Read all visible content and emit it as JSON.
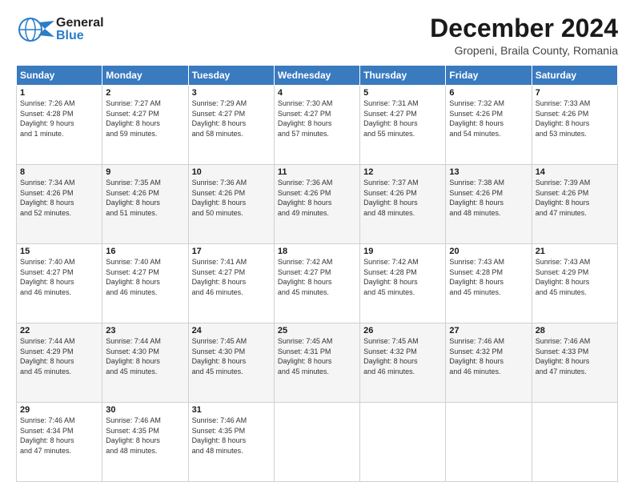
{
  "header": {
    "logo": {
      "line1": "General",
      "line2": "Blue"
    },
    "title": "December 2024",
    "subtitle": "Gropeni, Braila County, Romania"
  },
  "calendar": {
    "days_of_week": [
      "Sunday",
      "Monday",
      "Tuesday",
      "Wednesday",
      "Thursday",
      "Friday",
      "Saturday"
    ],
    "weeks": [
      [
        {
          "day": "1",
          "info": "Sunrise: 7:26 AM\nSunset: 4:28 PM\nDaylight: 9 hours\nand 1 minute."
        },
        {
          "day": "2",
          "info": "Sunrise: 7:27 AM\nSunset: 4:27 PM\nDaylight: 8 hours\nand 59 minutes."
        },
        {
          "day": "3",
          "info": "Sunrise: 7:29 AM\nSunset: 4:27 PM\nDaylight: 8 hours\nand 58 minutes."
        },
        {
          "day": "4",
          "info": "Sunrise: 7:30 AM\nSunset: 4:27 PM\nDaylight: 8 hours\nand 57 minutes."
        },
        {
          "day": "5",
          "info": "Sunrise: 7:31 AM\nSunset: 4:27 PM\nDaylight: 8 hours\nand 55 minutes."
        },
        {
          "day": "6",
          "info": "Sunrise: 7:32 AM\nSunset: 4:26 PM\nDaylight: 8 hours\nand 54 minutes."
        },
        {
          "day": "7",
          "info": "Sunrise: 7:33 AM\nSunset: 4:26 PM\nDaylight: 8 hours\nand 53 minutes."
        }
      ],
      [
        {
          "day": "8",
          "info": "Sunrise: 7:34 AM\nSunset: 4:26 PM\nDaylight: 8 hours\nand 52 minutes."
        },
        {
          "day": "9",
          "info": "Sunrise: 7:35 AM\nSunset: 4:26 PM\nDaylight: 8 hours\nand 51 minutes."
        },
        {
          "day": "10",
          "info": "Sunrise: 7:36 AM\nSunset: 4:26 PM\nDaylight: 8 hours\nand 50 minutes."
        },
        {
          "day": "11",
          "info": "Sunrise: 7:36 AM\nSunset: 4:26 PM\nDaylight: 8 hours\nand 49 minutes."
        },
        {
          "day": "12",
          "info": "Sunrise: 7:37 AM\nSunset: 4:26 PM\nDaylight: 8 hours\nand 48 minutes."
        },
        {
          "day": "13",
          "info": "Sunrise: 7:38 AM\nSunset: 4:26 PM\nDaylight: 8 hours\nand 48 minutes."
        },
        {
          "day": "14",
          "info": "Sunrise: 7:39 AM\nSunset: 4:26 PM\nDaylight: 8 hours\nand 47 minutes."
        }
      ],
      [
        {
          "day": "15",
          "info": "Sunrise: 7:40 AM\nSunset: 4:27 PM\nDaylight: 8 hours\nand 46 minutes."
        },
        {
          "day": "16",
          "info": "Sunrise: 7:40 AM\nSunset: 4:27 PM\nDaylight: 8 hours\nand 46 minutes."
        },
        {
          "day": "17",
          "info": "Sunrise: 7:41 AM\nSunset: 4:27 PM\nDaylight: 8 hours\nand 46 minutes."
        },
        {
          "day": "18",
          "info": "Sunrise: 7:42 AM\nSunset: 4:27 PM\nDaylight: 8 hours\nand 45 minutes."
        },
        {
          "day": "19",
          "info": "Sunrise: 7:42 AM\nSunset: 4:28 PM\nDaylight: 8 hours\nand 45 minutes."
        },
        {
          "day": "20",
          "info": "Sunrise: 7:43 AM\nSunset: 4:28 PM\nDaylight: 8 hours\nand 45 minutes."
        },
        {
          "day": "21",
          "info": "Sunrise: 7:43 AM\nSunset: 4:29 PM\nDaylight: 8 hours\nand 45 minutes."
        }
      ],
      [
        {
          "day": "22",
          "info": "Sunrise: 7:44 AM\nSunset: 4:29 PM\nDaylight: 8 hours\nand 45 minutes."
        },
        {
          "day": "23",
          "info": "Sunrise: 7:44 AM\nSunset: 4:30 PM\nDaylight: 8 hours\nand 45 minutes."
        },
        {
          "day": "24",
          "info": "Sunrise: 7:45 AM\nSunset: 4:30 PM\nDaylight: 8 hours\nand 45 minutes."
        },
        {
          "day": "25",
          "info": "Sunrise: 7:45 AM\nSunset: 4:31 PM\nDaylight: 8 hours\nand 45 minutes."
        },
        {
          "day": "26",
          "info": "Sunrise: 7:45 AM\nSunset: 4:32 PM\nDaylight: 8 hours\nand 46 minutes."
        },
        {
          "day": "27",
          "info": "Sunrise: 7:46 AM\nSunset: 4:32 PM\nDaylight: 8 hours\nand 46 minutes."
        },
        {
          "day": "28",
          "info": "Sunrise: 7:46 AM\nSunset: 4:33 PM\nDaylight: 8 hours\nand 47 minutes."
        }
      ],
      [
        {
          "day": "29",
          "info": "Sunrise: 7:46 AM\nSunset: 4:34 PM\nDaylight: 8 hours\nand 47 minutes."
        },
        {
          "day": "30",
          "info": "Sunrise: 7:46 AM\nSunset: 4:35 PM\nDaylight: 8 hours\nand 48 minutes."
        },
        {
          "day": "31",
          "info": "Sunrise: 7:46 AM\nSunset: 4:35 PM\nDaylight: 8 hours\nand 48 minutes."
        },
        {
          "day": "",
          "info": ""
        },
        {
          "day": "",
          "info": ""
        },
        {
          "day": "",
          "info": ""
        },
        {
          "day": "",
          "info": ""
        }
      ]
    ]
  }
}
